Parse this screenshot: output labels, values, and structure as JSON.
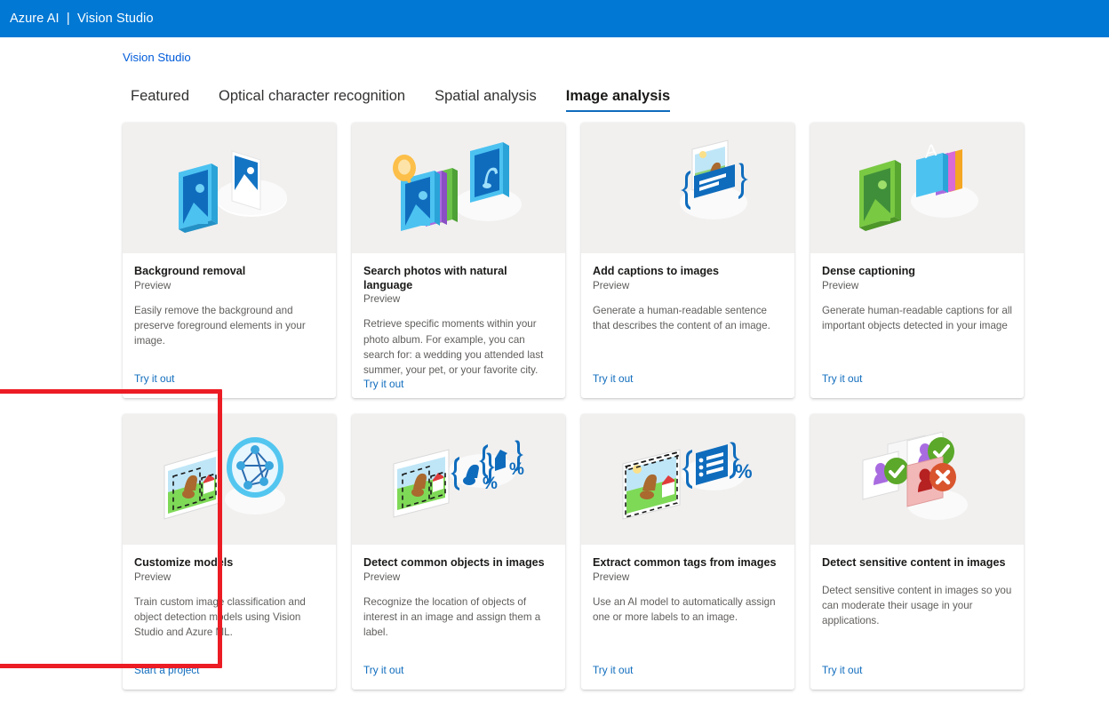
{
  "topbar": {
    "title": "Azure AI  |  Vision Studio"
  },
  "breadcrumb": {
    "label": "Vision Studio"
  },
  "tabs": [
    {
      "label": "Featured",
      "active": false
    },
    {
      "label": "Optical character recognition",
      "active": false
    },
    {
      "label": "Spatial analysis",
      "active": false
    },
    {
      "label": "Image analysis",
      "active": true
    }
  ],
  "cards": [
    {
      "title": "Background removal",
      "preview": "Preview",
      "description": "Easily remove the background and preserve foreground elements in your image.",
      "action": "Try it out",
      "icon": "two-images-icon"
    },
    {
      "title": "Search photos with natural language",
      "preview": "Preview",
      "description": "Retrieve specific moments within your photo album. For example, you can search for: a wedding you attended last summer, your pet, or your favorite city.",
      "action": "Try it out",
      "icon": "photo-search-stack-icon"
    },
    {
      "title": "Add captions to images",
      "preview": "Preview",
      "description": "Generate a human-readable sentence that describes the content of an image.",
      "action": "Try it out",
      "icon": "caption-image-icon"
    },
    {
      "title": "Dense captioning",
      "preview": "Preview",
      "description": "Generate human-readable captions for all important objects detected in your image",
      "action": "Try it out",
      "icon": "green-image-letter-stack-icon"
    },
    {
      "title": "Customize models",
      "preview": "Preview",
      "description": "Train custom image classification and object detection models using Vision Studio and Azure ML.",
      "action": "Start a project",
      "icon": "custom-model-graph-icon"
    },
    {
      "title": "Detect common objects in images",
      "preview": "Preview",
      "description": "Recognize the location of objects of interest in an image and assign them a label.",
      "action": "Try it out",
      "icon": "object-detection-icon"
    },
    {
      "title": "Extract common tags from images",
      "preview": "Preview",
      "description": "Use an AI model to automatically assign one or more labels to an image.",
      "action": "Try it out",
      "icon": "tag-extraction-icon"
    },
    {
      "title": "Detect sensitive content in images",
      "preview": "",
      "description": "Detect sensitive content in images so you can moderate their usage in your applications.",
      "action": "Try it out",
      "icon": "content-moderation-icon"
    }
  ],
  "colors": {
    "brand_blue": "#0078d4",
    "link_blue": "#0f6cbd",
    "tab_underline": "#0f6cbd",
    "highlight_red": "#ec1c24",
    "thumb_background": "#f1f0ef"
  },
  "annotation": {
    "highlighted_card": "Customize models"
  }
}
